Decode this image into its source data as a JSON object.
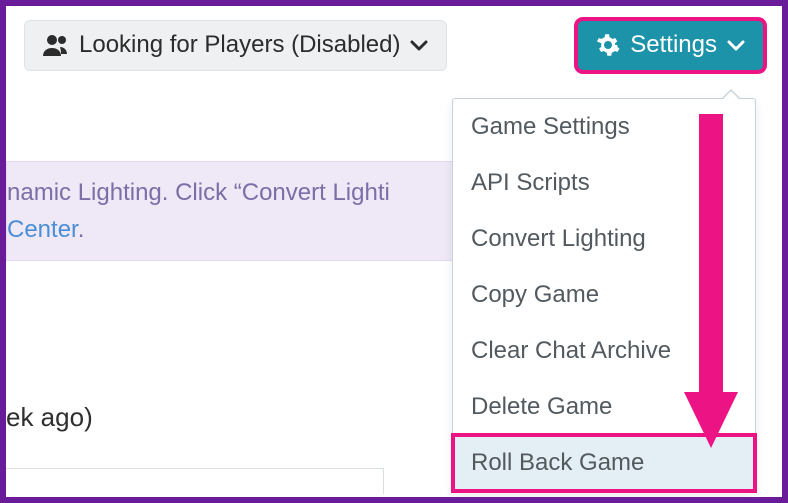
{
  "toolbar": {
    "lfp_label": "Looking for Players (Disabled)",
    "settings_label": "Settings"
  },
  "menu": {
    "items": [
      "Game Settings",
      "API Scripts",
      "Convert Lighting",
      "Copy Game",
      "Clear Chat Archive",
      "Delete Game",
      "Roll Back Game"
    ]
  },
  "banner": {
    "line1_fragment": "namic Lighting. Click “Convert Lighti",
    "help_link_fragment": "Center",
    "period": "."
  },
  "last_played_fragment": "ek ago)",
  "icons": {
    "people": "people-icon",
    "gear": "gear-icon",
    "caret": "chevron-down-icon"
  },
  "annotation": {
    "highlight_settings": true,
    "highlight_menu_index": 6,
    "arrow_color": "#ec1385"
  }
}
